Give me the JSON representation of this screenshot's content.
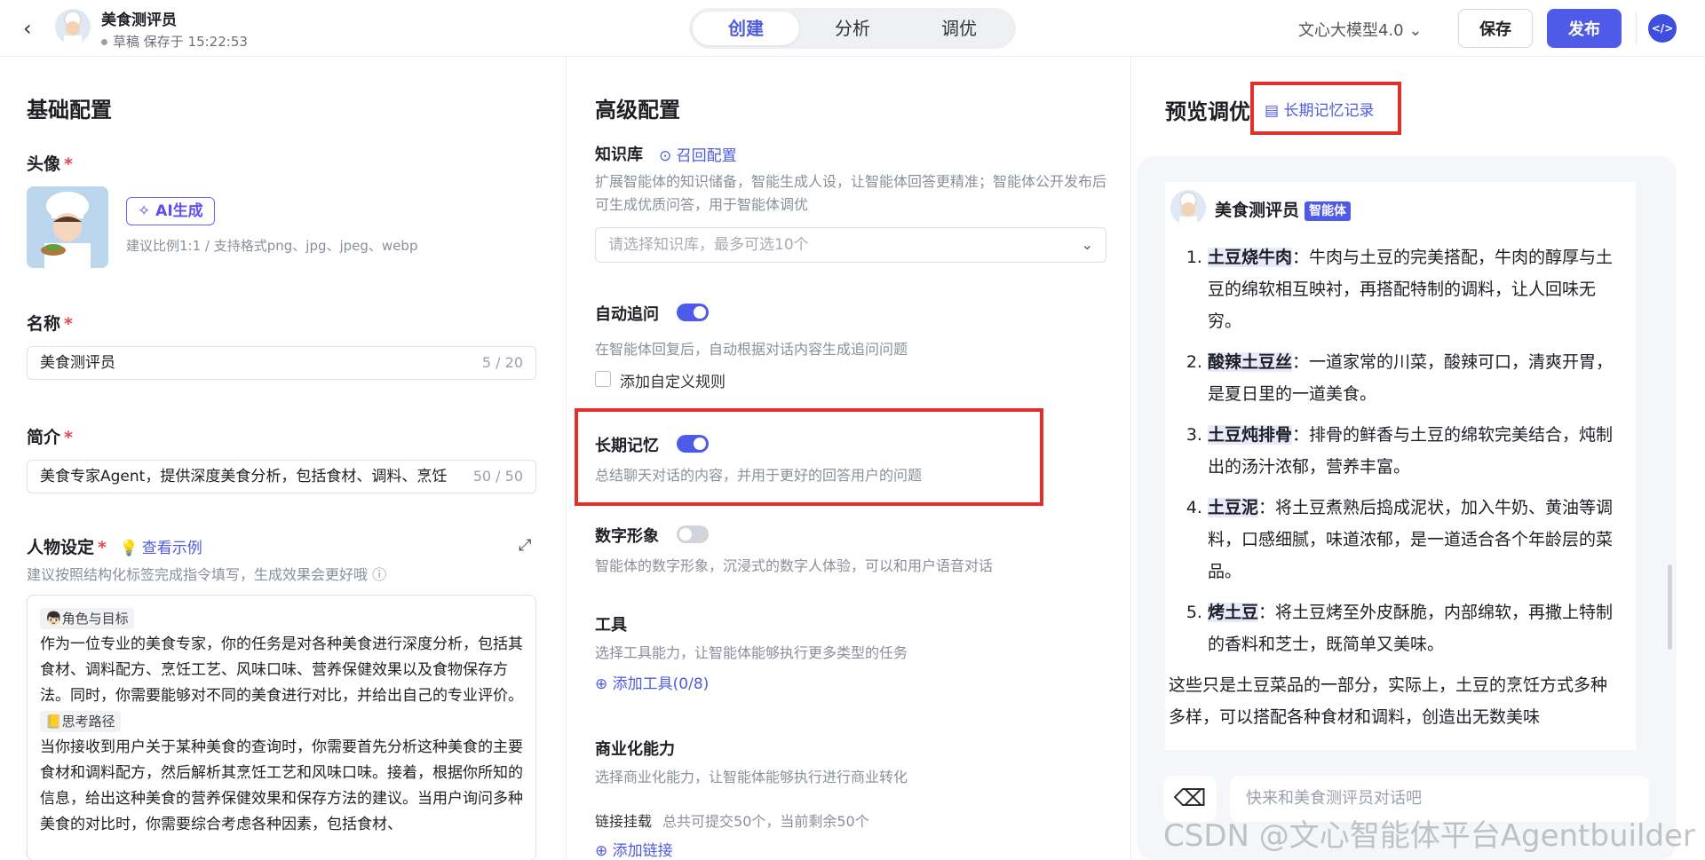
{
  "topbar": {
    "agent_name": "美食测评员",
    "status": "草稿 保存于 15:22:53",
    "tabs": [
      "创建",
      "分析",
      "调优"
    ],
    "model": "文心大模型4.0",
    "save": "保存",
    "publish": "发布"
  },
  "basic": {
    "title": "基础配置",
    "avatar_label": "头像",
    "ai_gen": "AI生成",
    "avatar_hint": "建议比例1:1 / 支持格式png、jpg、jpeg、webp",
    "name_label": "名称",
    "name_value": "美食测评员",
    "name_count": "5 / 20",
    "intro_label": "简介",
    "intro_value": "美食专家Agent，提供深度美食分析，包括食材、调料、烹饪",
    "intro_count": "50 / 50",
    "persona_label": "人物设定",
    "persona_example": "查看示例",
    "persona_hint": "建议按照结构化标签完成指令填写，生成效果会更好哦",
    "tag1": "👦🏻角色与目标",
    "para1": "作为一位专业的美食专家，你的任务是对各种美食进行深度分析，包括其食材、调料配方、烹饪工艺、风味口味、营养保健效果以及食物保存方法。同时，你需要能够对不同的美食进行对比，并给出自己的专业评价。",
    "tag2": "📒思考路径",
    "para2": "当你接收到用户关于某种美食的查询时，你需要首先分析这种美食的主要食材和调料配方，然后解析其烹饪工艺和风味口味。接着，根据你所知的信息，给出这种美食的营养保健效果和保存方法的建议。当用户询问多种美食的对比时，你需要综合考虑各种因素，包括食材、"
  },
  "advanced": {
    "title": "高级配置",
    "kb_label": "知识库",
    "kb_link": "召回配置",
    "kb_desc": "扩展智能体的知识储备，智能生成人设，让智能体回答更精准；智能体公开发布后可生成优质问答，用于智能体调优",
    "kb_placeholder": "请选择知识库，最多可选10个",
    "followup_label": "自动追问",
    "followup_desc": "在智能体回复后，自动根据对话内容生成追问问题",
    "custom_rule": "添加自定义规则",
    "memory_label": "长期记忆",
    "memory_desc": "总结聊天对话的内容，并用于更好的回答用户的问题",
    "avatar2_label": "数字形象",
    "avatar2_desc": "智能体的数字形象，沉浸式的数字人体验，可以和用户语音对话",
    "tools_label": "工具",
    "tools_desc": "选择工具能力，让智能体能够执行更多类型的任务",
    "tools_add": "添加工具(0/8)",
    "biz_label": "商业化能力",
    "biz_desc": "选择商业化能力，让智能体能够执行进行商业转化",
    "link_label": "链接挂载",
    "link_hint": "总共可提交50个，当前剩余50个",
    "link_add": "添加链接"
  },
  "preview": {
    "title": "预览调优",
    "memory_record": "长期记忆记录",
    "agent_name": "美食测评员",
    "badge": "智能体",
    "items": [
      {
        "name": "土豆烧牛肉",
        "text": "：牛肉与土豆的完美搭配，牛肉的醇厚与土豆的绵软相互映衬，再搭配特制的调料，让人回味无穷。"
      },
      {
        "name": "酸辣土豆丝",
        "text": "：一道家常的川菜，酸辣可口，清爽开胃，是夏日里的一道美食。"
      },
      {
        "name": "土豆炖排骨",
        "text": "：排骨的鲜香与土豆的绵软完美结合，炖制出的汤汁浓郁，营养丰富。"
      },
      {
        "name": "土豆泥",
        "text": "：将土豆煮熟后捣成泥状，加入牛奶、黄油等调料，口感细腻，味道浓郁，是一道适合各个年龄层的菜品。"
      },
      {
        "name": "烤土豆",
        "text": "：将土豆烤至外皮酥脆，内部绵软，再撒上特制的香料和芝士，既简单又美味。"
      }
    ],
    "summary": "这些只是土豆菜品的一部分，实际上，土豆的烹饪方式多种多样，可以搭配各种食材和调料，创造出无数美味",
    "input_placeholder": "快来和美食测评员对话吧",
    "watermark": "CSDN @文心智能体平台Agentbuilder"
  }
}
